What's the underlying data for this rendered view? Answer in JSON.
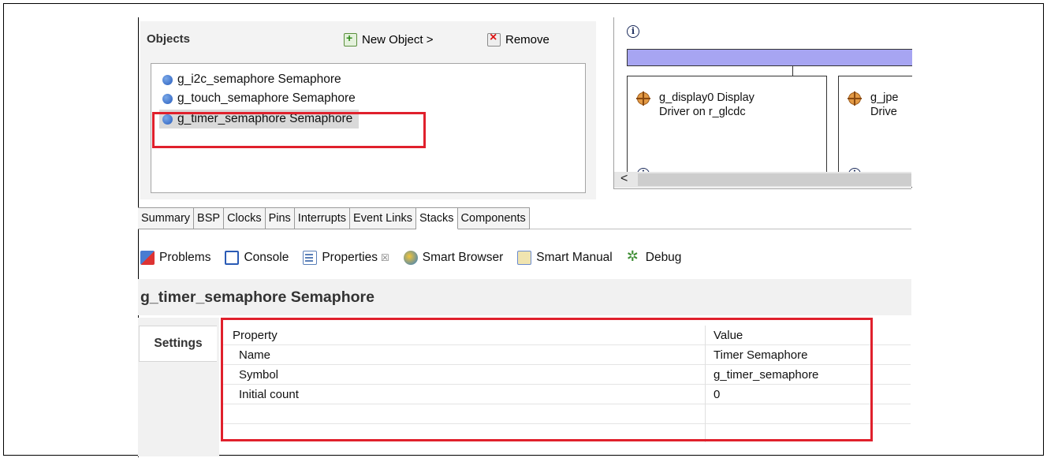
{
  "objects": {
    "header": "Objects",
    "new_object_label": "New Object >",
    "remove_label": "Remove",
    "items": [
      {
        "label": "g_i2c_semaphore Semaphore"
      },
      {
        "label": "g_touch_semaphore Semaphore"
      },
      {
        "label": "g_timer_semaphore Semaphore"
      }
    ]
  },
  "diagram": {
    "info_glyph": "i",
    "drivers": [
      {
        "title_line1": "g_display0 Display",
        "title_line2": "Driver on r_glcdc"
      },
      {
        "title_line1": "g_jpe",
        "title_line2": "Drive"
      }
    ],
    "scroll_left_glyph": "<"
  },
  "tabs": [
    "Summary",
    "BSP",
    "Clocks",
    "Pins",
    "Interrupts",
    "Event Links",
    "Stacks",
    "Components"
  ],
  "active_tab": "Stacks",
  "views": {
    "problems": "Problems",
    "console": "Console",
    "properties": "Properties",
    "properties_close": "☒",
    "smart_browser": "Smart Browser",
    "smart_manual": "Smart Manual",
    "debug": "Debug"
  },
  "properties": {
    "title": "g_timer_semaphore Semaphore",
    "settings_tab": "Settings",
    "col_property": "Property",
    "col_value": "Value",
    "rows": [
      {
        "name": "Name",
        "value": "Timer Semaphore"
      },
      {
        "name": "Symbol",
        "value": "g_timer_semaphore"
      },
      {
        "name": "Initial count",
        "value": "0"
      }
    ]
  },
  "colors": {
    "highlight_red": "#e0202c",
    "purple_bar": "#a7a5f2",
    "selection_gray": "#d9d9d9"
  }
}
